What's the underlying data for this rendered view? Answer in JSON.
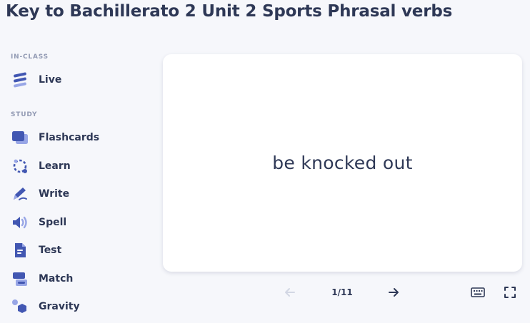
{
  "page": {
    "title": "Key to Bachillerato 2 Unit 2 Sports Phrasal verbs"
  },
  "sidebar": {
    "in_class_label": "IN-CLASS",
    "study_label": "STUDY",
    "in_class_items": [
      {
        "label": "Live",
        "icon": "live-icon"
      }
    ],
    "study_items": [
      {
        "label": "Flashcards",
        "icon": "flashcards-icon"
      },
      {
        "label": "Learn",
        "icon": "learn-icon"
      },
      {
        "label": "Write",
        "icon": "write-icon"
      },
      {
        "label": "Spell",
        "icon": "spell-icon"
      },
      {
        "label": "Test",
        "icon": "test-icon"
      },
      {
        "label": "Match",
        "icon": "match-icon"
      },
      {
        "label": "Gravity",
        "icon": "gravity-icon"
      }
    ]
  },
  "flashcard": {
    "term": "be knocked out"
  },
  "controls": {
    "counter": "1/11"
  },
  "colors": {
    "icon_primary": "#4257b2",
    "icon_light": "#98a6e6",
    "text": "#2e3856",
    "muted": "#939bb4",
    "background": "#f6f7fb",
    "card": "#ffffff"
  }
}
